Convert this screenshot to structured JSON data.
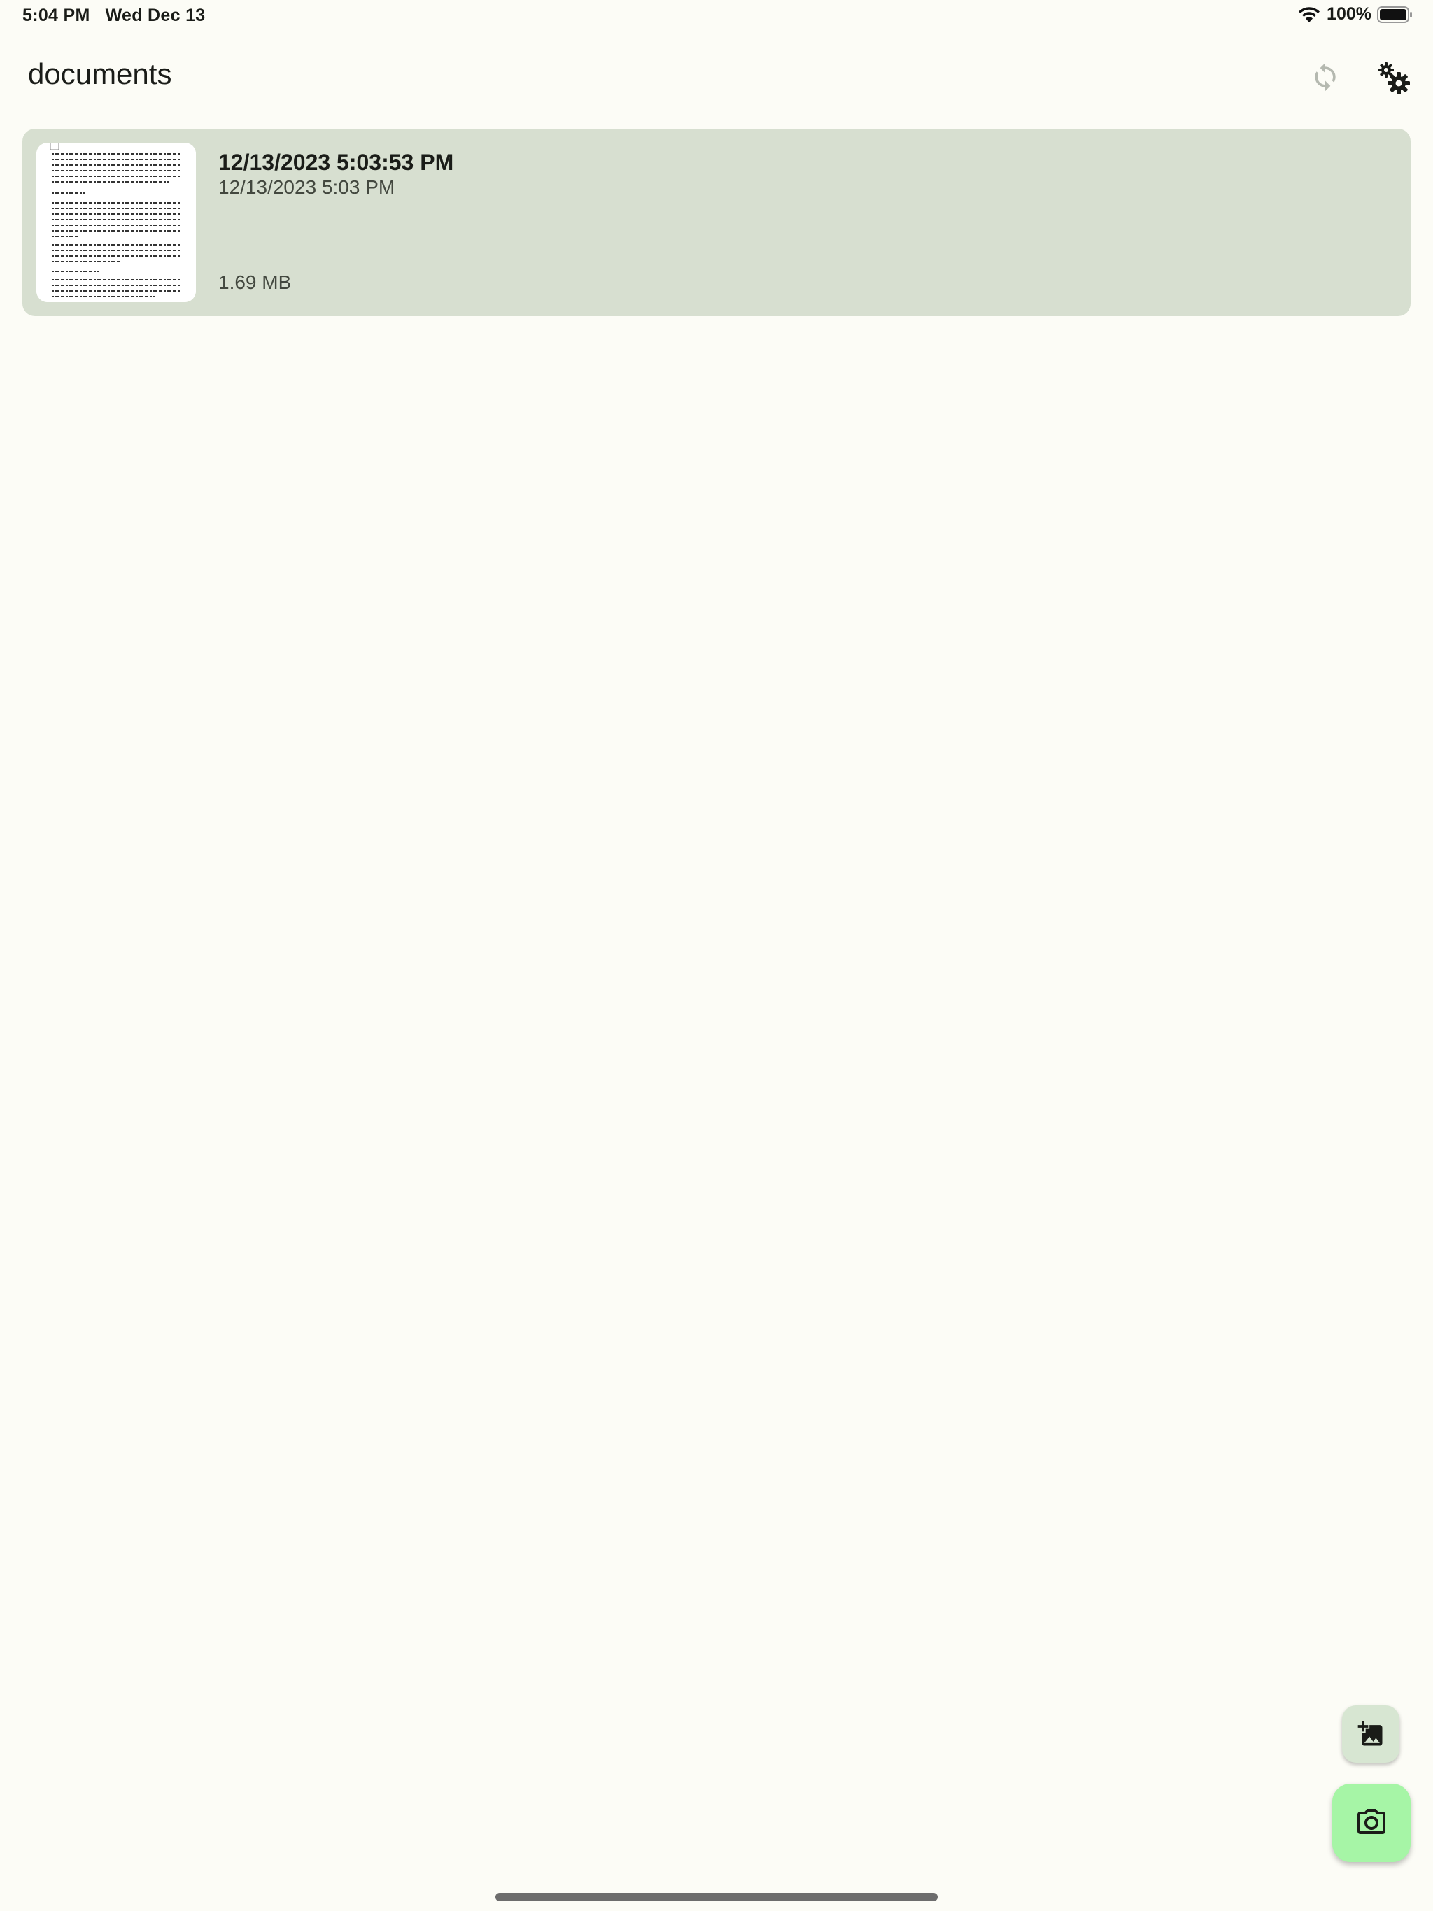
{
  "status_bar": {
    "time": "5:04 PM",
    "date": "Wed Dec 13",
    "battery": "100%",
    "icons": [
      "wifi-icon",
      "battery-icon"
    ]
  },
  "header": {
    "title": "documents",
    "icons": [
      "sync-icon",
      "settings-gears-icon"
    ]
  },
  "documents": [
    {
      "name": "12/13/2023 5:03:53 PM",
      "date": "12/13/2023 5:03 PM",
      "size": "1.69 MB"
    }
  ],
  "fabs": {
    "add_image_icon": "add-photo-icon",
    "camera_icon": "camera-icon"
  },
  "colors": {
    "background": "#fcfcf6",
    "card": "#d7dfd0",
    "fab_primary": "#a6f5a6",
    "fab_secondary": "#d7e6d2"
  }
}
